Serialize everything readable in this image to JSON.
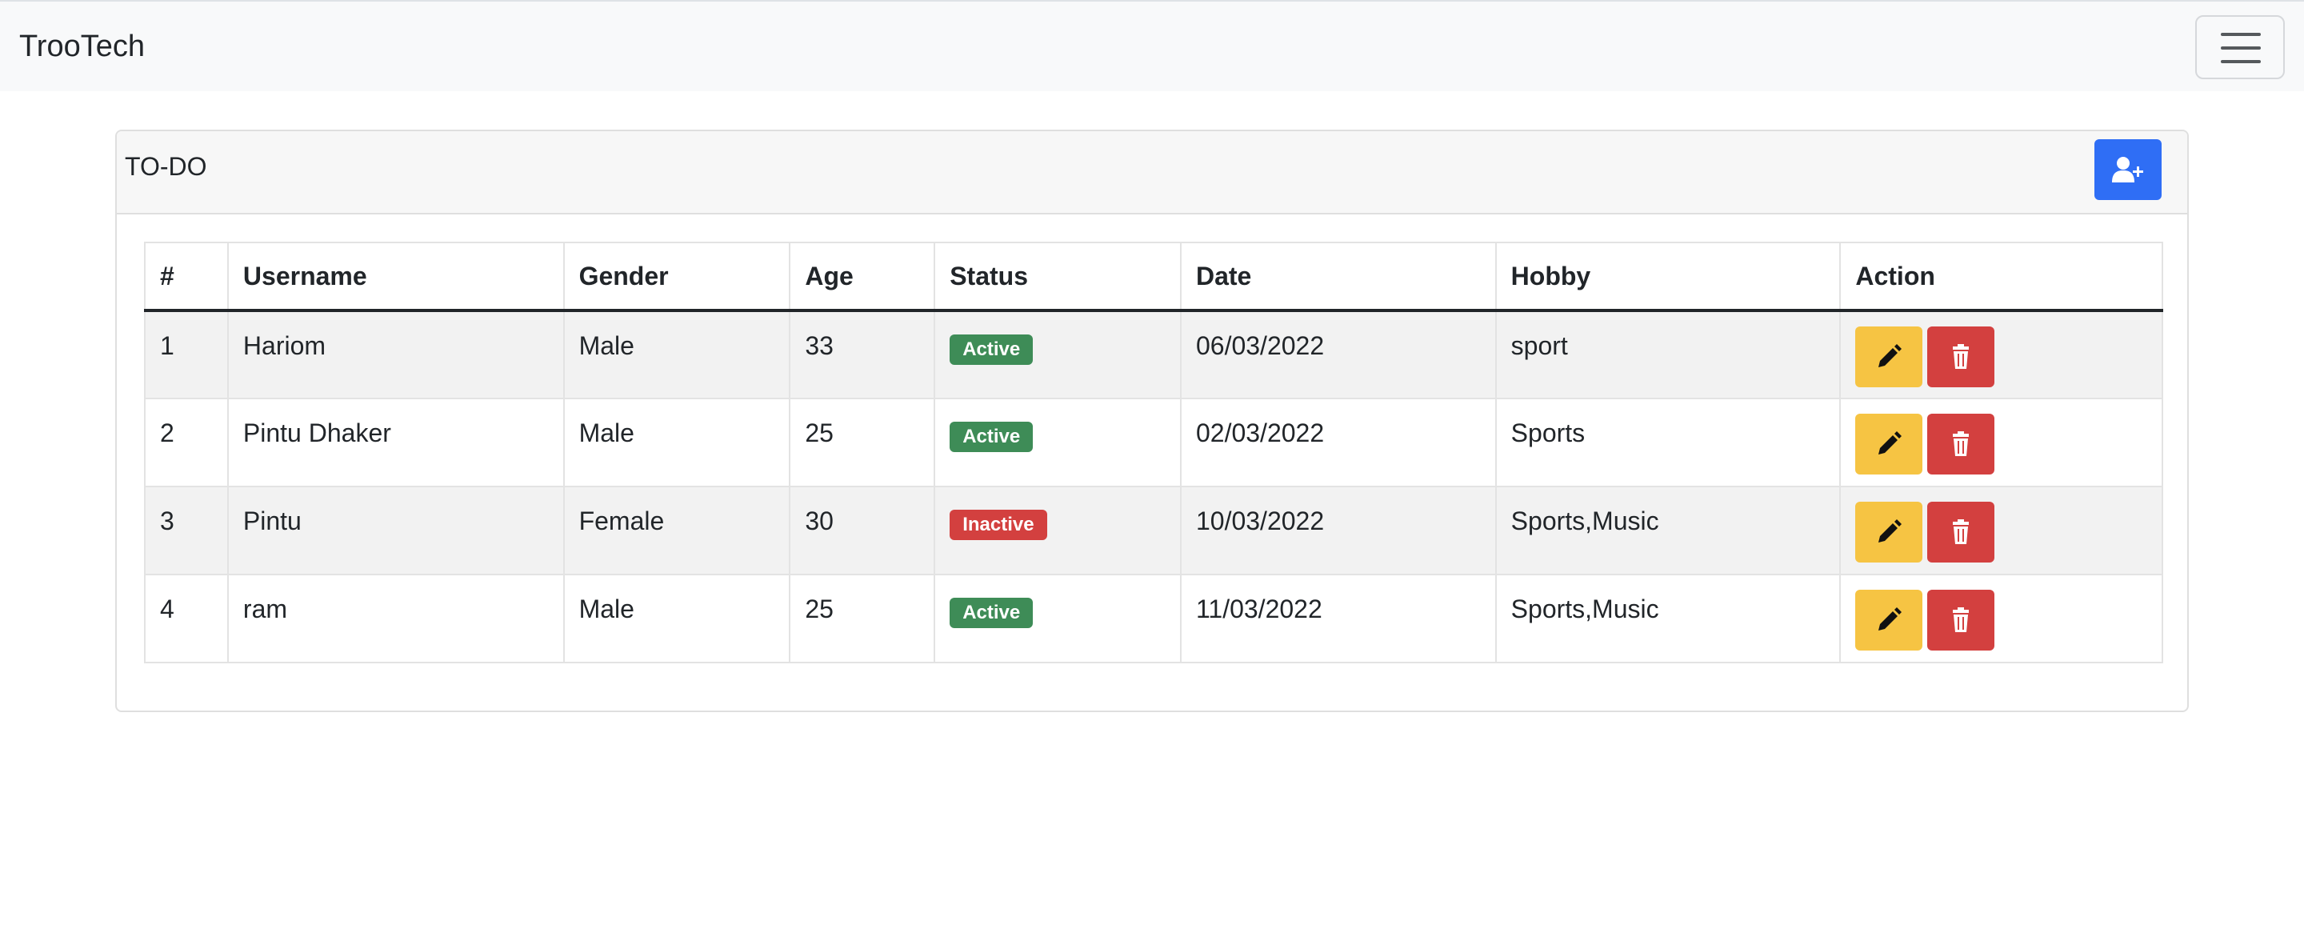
{
  "navbar": {
    "brand": "TrooTech"
  },
  "card": {
    "title": "TO-DO"
  },
  "table": {
    "headers": [
      "#",
      "Username",
      "Gender",
      "Age",
      "Status",
      "Date",
      "Hobby",
      "Action"
    ],
    "rows": [
      {
        "id": "1",
        "username": "Hariom",
        "gender": "Male",
        "age": "33",
        "status": "Active",
        "date": "06/03/2022",
        "hobby": "sport"
      },
      {
        "id": "2",
        "username": "Pintu Dhaker",
        "gender": "Male",
        "age": "25",
        "status": "Active",
        "date": "02/03/2022",
        "hobby": "Sports"
      },
      {
        "id": "3",
        "username": "Pintu",
        "gender": "Female",
        "age": "30",
        "status": "Inactive",
        "date": "10/03/2022",
        "hobby": "Sports,Music"
      },
      {
        "id": "4",
        "username": "ram",
        "gender": "Male",
        "age": "25",
        "status": "Active",
        "date": "11/03/2022",
        "hobby": "Sports,Music"
      }
    ]
  },
  "icons": {
    "menu": "hamburger-menu-icon",
    "add_user": "user-plus-icon",
    "edit": "pencil-icon",
    "delete": "trash-icon"
  },
  "colors": {
    "primary": "#2f6ef5",
    "warning": "#f6c443",
    "danger": "#d3403f",
    "success": "#3e8c57"
  }
}
